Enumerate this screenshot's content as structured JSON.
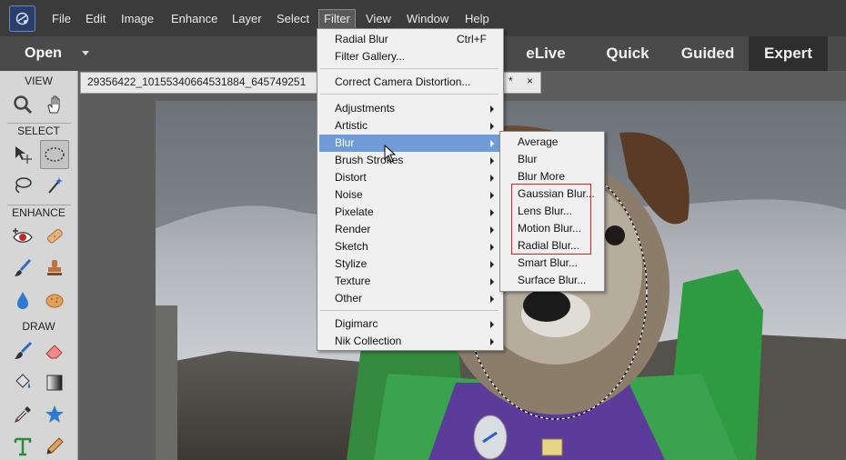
{
  "menubar": {
    "items": [
      {
        "label": "File"
      },
      {
        "label": "Edit"
      },
      {
        "label": "Image"
      },
      {
        "label": "Enhance"
      },
      {
        "label": "Layer"
      },
      {
        "label": "Select"
      },
      {
        "label": "Filter"
      },
      {
        "label": "View"
      },
      {
        "label": "Window"
      },
      {
        "label": "Help"
      }
    ],
    "active_item": "Filter"
  },
  "modebar": {
    "open_label": "Open",
    "tabs": [
      {
        "label": "eLive"
      },
      {
        "label": "Quick"
      },
      {
        "label": "Guided"
      },
      {
        "label": "Expert"
      }
    ],
    "active_tab": "Expert"
  },
  "toolbox": {
    "sections": [
      {
        "label": "VIEW"
      },
      {
        "label": "SELECT"
      },
      {
        "label": "ENHANCE"
      },
      {
        "label": "DRAW"
      }
    ]
  },
  "document": {
    "tab_name": "29356422_10155340664531884_645749251",
    "modified_marker": "*",
    "close_glyph": "×"
  },
  "filter_menu": {
    "items": [
      {
        "label": "Radial Blur",
        "shortcut": "Ctrl+F"
      },
      {
        "label": "Filter Gallery..."
      },
      {
        "label": "Correct Camera Distortion..."
      },
      {
        "label": "Adjustments"
      },
      {
        "label": "Artistic"
      },
      {
        "label": "Blur"
      },
      {
        "label": "Brush Strokes"
      },
      {
        "label": "Distort"
      },
      {
        "label": "Noise"
      },
      {
        "label": "Pixelate"
      },
      {
        "label": "Render"
      },
      {
        "label": "Sketch"
      },
      {
        "label": "Stylize"
      },
      {
        "label": "Texture"
      },
      {
        "label": "Other"
      },
      {
        "label": "Digimarc"
      },
      {
        "label": "Nik Collection"
      }
    ],
    "highlighted": "Blur"
  },
  "blur_submenu": {
    "items": [
      {
        "label": "Average"
      },
      {
        "label": "Blur"
      },
      {
        "label": "Blur More"
      },
      {
        "label": "Gaussian Blur..."
      },
      {
        "label": "Lens Blur..."
      },
      {
        "label": "Motion Blur..."
      },
      {
        "label": "Radial Blur..."
      },
      {
        "label": "Smart Blur..."
      },
      {
        "label": "Surface Blur..."
      }
    ],
    "emphasis_color": "#e01f1f"
  },
  "colors": {
    "menu_highlight": "#6f9bd8",
    "menubar_bg": "#3b3b3b",
    "toolbox_bg": "#d6d6d6"
  }
}
